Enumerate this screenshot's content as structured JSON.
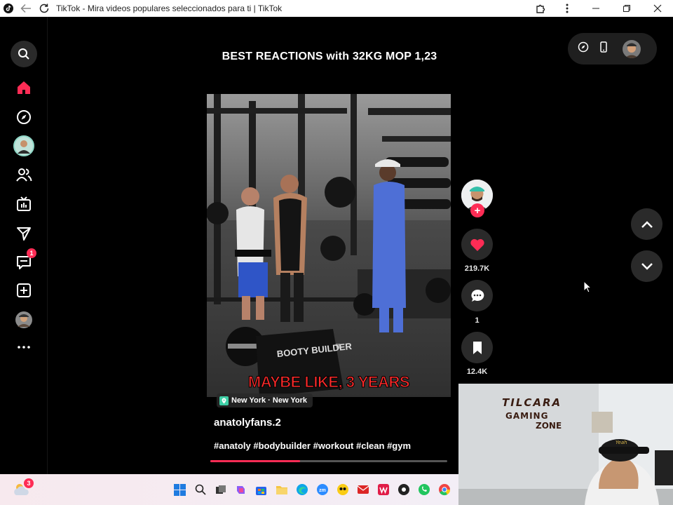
{
  "window": {
    "title": "TikTok - Mira videos populares seleccionados para ti | TikTok"
  },
  "sidebar": {
    "items": [
      {
        "icon": "search-icon"
      },
      {
        "icon": "home-icon",
        "active": true,
        "color": "#fe2c55"
      },
      {
        "icon": "compass-icon"
      },
      {
        "icon": "following-avatar"
      },
      {
        "icon": "friends-icon"
      },
      {
        "icon": "live-tv-icon"
      },
      {
        "icon": "send-icon"
      },
      {
        "icon": "inbox-icon",
        "badge": "1"
      },
      {
        "icon": "upload-icon"
      },
      {
        "icon": "profile-avatar"
      },
      {
        "icon": "more-icon"
      }
    ]
  },
  "video": {
    "title": "BEST REACTIONS with 32KG MOP 1,23",
    "caption": "MAYBE LIKE, 3 YEARS",
    "location": "New York · New York",
    "author": "anatolyfans.2",
    "hashtags": "#anatoly #bodybuilder #workout #clean #gym",
    "progress": 0.38,
    "brand_on_box": "BOOTY BUILDER"
  },
  "actions": {
    "likes": "219.7K",
    "comments": "1",
    "saves": "12.4K"
  },
  "webcam": {
    "line1": "TILCARA",
    "line2": "GAMING",
    "line3": "ZONE"
  },
  "taskbar": {
    "weather_badge": "3"
  },
  "colors": {
    "accent": "#fe2c55",
    "background": "#000000",
    "caption": "#ff2a2a"
  }
}
